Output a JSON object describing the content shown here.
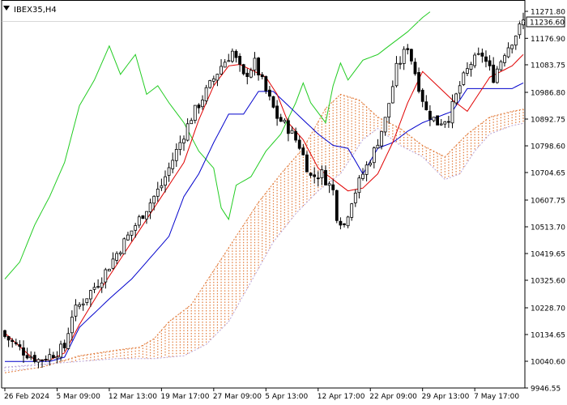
{
  "chart_data": {
    "type": "candlestick",
    "title": "IBEX35,H4",
    "current_price": "11236.60",
    "ylim": [
      9946.55,
      11271.8
    ],
    "y_ticks": [
      "11271.80",
      "11176.90",
      "11083.75",
      "10986.80",
      "10892.75",
      "10798.60",
      "10704.65",
      "10607.75",
      "10513.70",
      "10419.65",
      "10325.60",
      "10228.70",
      "10134.65",
      "10040.60",
      "9946.55"
    ],
    "x_ticks": [
      "26 Feb 2024",
      "5 Mar 09:00",
      "12 Mar 13:00",
      "19 Mar 17:00",
      "27 Mar 09:00",
      "5 Apr 13:00",
      "12 Apr 17:00",
      "22 Apr 09:00",
      "29 Apr 13:00",
      "7 May 17:00"
    ],
    "x_tick_index": [
      0,
      14,
      28,
      42,
      56,
      70,
      84,
      98,
      112,
      126
    ],
    "n_bars": 140,
    "close_anchors": [
      [
        0,
        10128
      ],
      [
        5,
        10075
      ],
      [
        9,
        10045
      ],
      [
        12,
        10060
      ],
      [
        16,
        10090
      ],
      [
        18,
        10205
      ],
      [
        22,
        10270
      ],
      [
        26,
        10335
      ],
      [
        30,
        10420
      ],
      [
        34,
        10500
      ],
      [
        38,
        10580
      ],
      [
        42,
        10660
      ],
      [
        46,
        10780
      ],
      [
        50,
        10900
      ],
      [
        54,
        10990
      ],
      [
        58,
        11080
      ],
      [
        61,
        11130
      ],
      [
        64,
        11040
      ],
      [
        67,
        11090
      ],
      [
        70,
        10990
      ],
      [
        73,
        10900
      ],
      [
        76,
        10860
      ],
      [
        79,
        10800
      ],
      [
        82,
        10690
      ],
      [
        85,
        10700
      ],
      [
        88,
        10640
      ],
      [
        89,
        10555
      ],
      [
        91,
        10520
      ],
      [
        93,
        10610
      ],
      [
        96,
        10700
      ],
      [
        99,
        10780
      ],
      [
        102,
        10890
      ],
      [
        105,
        11070
      ],
      [
        108,
        11150
      ],
      [
        111,
        11010
      ],
      [
        113,
        10920
      ],
      [
        116,
        10880
      ],
      [
        119,
        10900
      ],
      [
        122,
        11010
      ],
      [
        125,
        11090
      ],
      [
        128,
        11120
      ],
      [
        131,
        11040
      ],
      [
        134,
        11130
      ],
      [
        136,
        11170
      ],
      [
        139,
        11236
      ]
    ],
    "tenkan_anchors": [
      [
        0,
        10140
      ],
      [
        8,
        10045
      ],
      [
        12,
        10045
      ],
      [
        16,
        10070
      ],
      [
        20,
        10170
      ],
      [
        26,
        10300
      ],
      [
        32,
        10420
      ],
      [
        38,
        10540
      ],
      [
        42,
        10620
      ],
      [
        48,
        10740
      ],
      [
        52,
        10890
      ],
      [
        56,
        11010
      ],
      [
        60,
        11080
      ],
      [
        63,
        11085
      ],
      [
        67,
        11060
      ],
      [
        70,
        11040
      ],
      [
        73,
        10980
      ],
      [
        76,
        10880
      ],
      [
        80,
        10820
      ],
      [
        84,
        10720
      ],
      [
        88,
        10680
      ],
      [
        92,
        10640
      ],
      [
        96,
        10650
      ],
      [
        100,
        10700
      ],
      [
        104,
        10810
      ],
      [
        108,
        10950
      ],
      [
        112,
        11060
      ],
      [
        116,
        11010
      ],
      [
        120,
        10960
      ],
      [
        124,
        10920
      ],
      [
        127,
        10980
      ],
      [
        130,
        11040
      ],
      [
        133,
        11060
      ],
      [
        136,
        11080
      ],
      [
        139,
        11120
      ]
    ],
    "kijun_anchors": [
      [
        0,
        10040
      ],
      [
        12,
        10040
      ],
      [
        16,
        10055
      ],
      [
        20,
        10160
      ],
      [
        28,
        10260
      ],
      [
        34,
        10330
      ],
      [
        40,
        10420
      ],
      [
        44,
        10480
      ],
      [
        48,
        10620
      ],
      [
        52,
        10700
      ],
      [
        56,
        10810
      ],
      [
        60,
        10910
      ],
      [
        64,
        10910
      ],
      [
        68,
        10990
      ],
      [
        72,
        10990
      ],
      [
        76,
        10940
      ],
      [
        80,
        10890
      ],
      [
        84,
        10840
      ],
      [
        88,
        10800
      ],
      [
        92,
        10790
      ],
      [
        96,
        10700
      ],
      [
        100,
        10790
      ],
      [
        104,
        10810
      ],
      [
        108,
        10850
      ],
      [
        112,
        10880
      ],
      [
        116,
        10900
      ],
      [
        120,
        10920
      ],
      [
        124,
        11000
      ],
      [
        128,
        11000
      ],
      [
        132,
        11000
      ],
      [
        136,
        11000
      ],
      [
        139,
        11020
      ]
    ],
    "chikou_anchors": [
      [
        0,
        10330
      ],
      [
        4,
        10390
      ],
      [
        8,
        10520
      ],
      [
        12,
        10620
      ],
      [
        16,
        10740
      ],
      [
        20,
        10940
      ],
      [
        24,
        11030
      ],
      [
        28,
        11150
      ],
      [
        31,
        11050
      ],
      [
        35,
        11120
      ],
      [
        38,
        10980
      ],
      [
        41,
        11010
      ],
      [
        44,
        10950
      ],
      [
        48,
        10880
      ],
      [
        52,
        10780
      ],
      [
        56,
        10720
      ],
      [
        58,
        10580
      ],
      [
        60,
        10540
      ],
      [
        62,
        10660
      ],
      [
        66,
        10690
      ],
      [
        70,
        10780
      ],
      [
        74,
        10840
      ],
      [
        78,
        10950
      ],
      [
        80,
        11020
      ],
      [
        82,
        10950
      ],
      [
        86,
        10880
      ],
      [
        88,
        11010
      ],
      [
        90,
        11090
      ],
      [
        92,
        11030
      ],
      [
        96,
        11100
      ],
      [
        100,
        11120
      ],
      [
        104,
        11160
      ],
      [
        108,
        11200
      ],
      [
        112,
        11250
      ],
      [
        114,
        11270
      ]
    ],
    "span_a_anchors": [
      [
        0,
        10000
      ],
      [
        10,
        10020
      ],
      [
        20,
        10060
      ],
      [
        30,
        10080
      ],
      [
        36,
        10090
      ],
      [
        40,
        10120
      ],
      [
        44,
        10180
      ],
      [
        50,
        10240
      ],
      [
        56,
        10360
      ],
      [
        62,
        10480
      ],
      [
        68,
        10600
      ],
      [
        74,
        10700
      ],
      [
        80,
        10790
      ],
      [
        86,
        10930
      ],
      [
        90,
        10980
      ],
      [
        95,
        10960
      ],
      [
        100,
        10900
      ],
      [
        106,
        10860
      ],
      [
        112,
        10800
      ],
      [
        118,
        10760
      ],
      [
        124,
        10840
      ],
      [
        130,
        10900
      ],
      [
        136,
        10920
      ],
      [
        140,
        10930
      ]
    ],
    "span_b_anchors": [
      [
        0,
        10020
      ],
      [
        10,
        10030
      ],
      [
        20,
        10040
      ],
      [
        30,
        10050
      ],
      [
        40,
        10050
      ],
      [
        48,
        10060
      ],
      [
        54,
        10100
      ],
      [
        60,
        10180
      ],
      [
        66,
        10320
      ],
      [
        72,
        10460
      ],
      [
        78,
        10560
      ],
      [
        84,
        10640
      ],
      [
        90,
        10700
      ],
      [
        96,
        10820
      ],
      [
        100,
        10860
      ],
      [
        106,
        10800
      ],
      [
        112,
        10760
      ],
      [
        118,
        10680
      ],
      [
        122,
        10700
      ],
      [
        126,
        10780
      ],
      [
        130,
        10840
      ],
      [
        136,
        10870
      ],
      [
        140,
        10880
      ]
    ],
    "colors": {
      "bull_body": "#ffffff",
      "bear_body": "#000000",
      "wick": "#000000",
      "tenkan": "#e00000",
      "kijun": "#0000cc",
      "chikou": "#22cc22",
      "cloud_bull": "#e27b3a",
      "cloud_bear": "#b9a4d8",
      "grid_axis": "#000000"
    },
    "grid": false,
    "legend": "none"
  }
}
